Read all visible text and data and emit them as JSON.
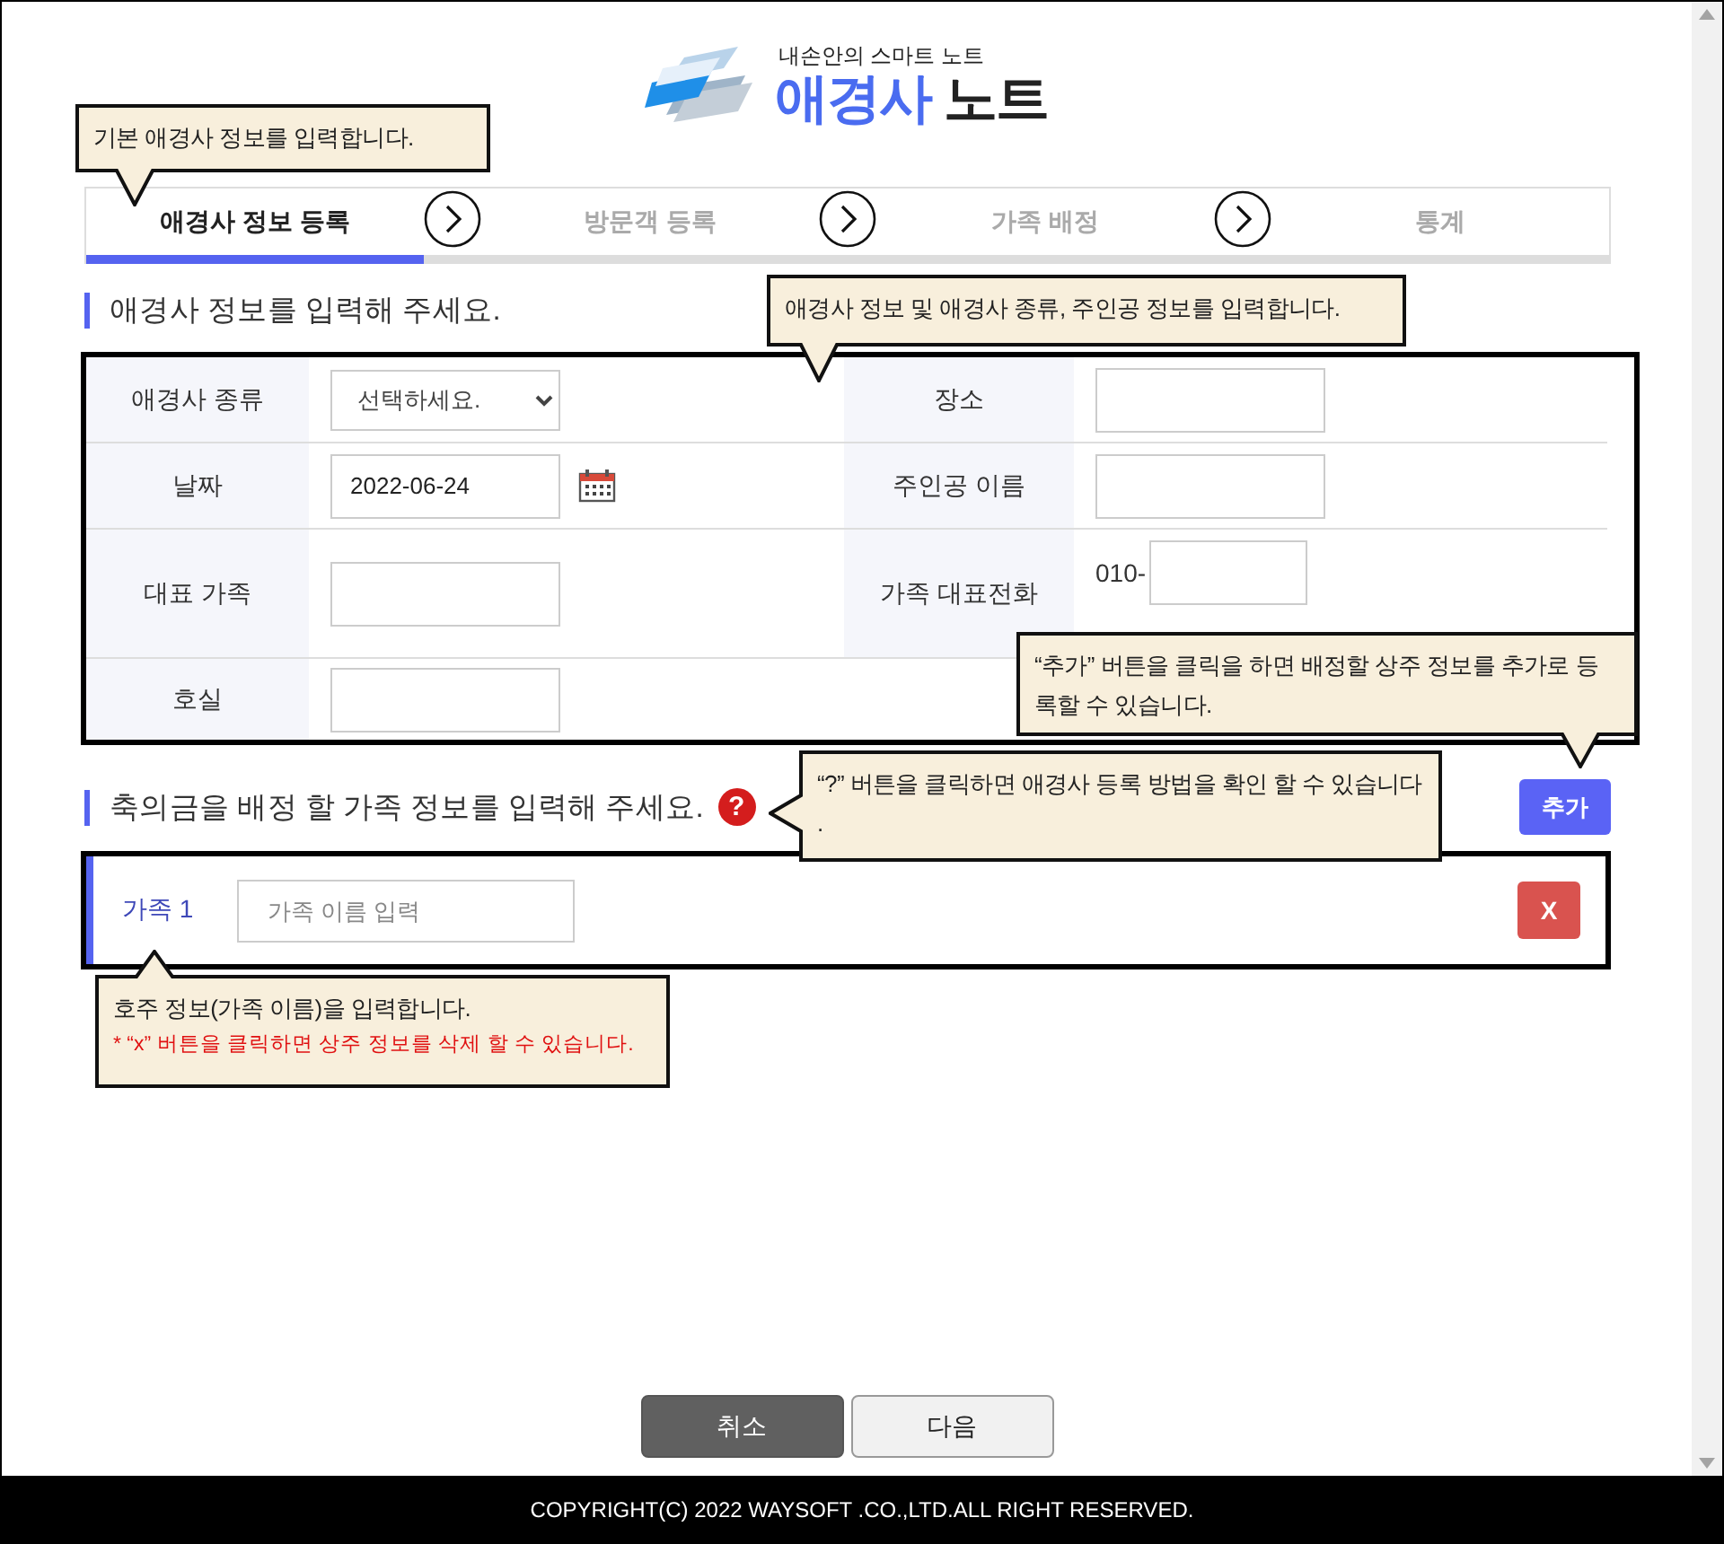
{
  "header": {
    "subtitle": "내손안의 스마트 노트",
    "title_accent": "애경사",
    "title_rest": "노트"
  },
  "steps": [
    {
      "label": "애경사 정보 등록",
      "selected": true
    },
    {
      "label": "방문객 등록",
      "selected": false
    },
    {
      "label": "가족 배정",
      "selected": false
    },
    {
      "label": "통계",
      "selected": false
    }
  ],
  "basic_info": {
    "heading": "애경사 정보를 입력해 주세요.",
    "rows": [
      [
        {
          "label": "애경사 종류",
          "kind": "select",
          "value": "선택하세요."
        },
        {
          "label": "장소",
          "kind": "text"
        }
      ],
      [
        {
          "label": "날짜",
          "kind": "date",
          "value": "2022-06-24"
        },
        {
          "label": "주인공 이름",
          "kind": "text"
        }
      ],
      [
        {
          "label": "대표 가족",
          "kind": "text"
        },
        {
          "label": "가족 대표전화",
          "kind": "phone",
          "prefix": "010-"
        }
      ],
      [
        {
          "label": "호실",
          "kind": "text"
        }
      ]
    ]
  },
  "family": {
    "heading": "축의금을 배정 할 가족 정보를 입력해 주세요.",
    "help": "?",
    "add_button": "추가",
    "rows": [
      {
        "label": "가족 1",
        "placeholder": "가족 이름 입력",
        "delete_button": "X"
      }
    ]
  },
  "actions": [
    {
      "label": "취소",
      "kind": "primary"
    },
    {
      "label": "다음",
      "kind": "secondary"
    }
  ],
  "tooltips": [
    {
      "text": "기본 애경사 정보를 입력합니다."
    },
    {
      "text": "애경사 정보 및 애경사 종류, 주인공 정보를 입력합니다."
    },
    {
      "text": "“추가” 버튼을 클릭을 하면 배정할 상주 정보를 추가로 등록할 수 있습니다."
    },
    {
      "text": "“?” 버튼을 클릭하면  애경사 등록 방법을 확인 할 수 있습니다 ."
    },
    {
      "text": "호주 정보(가족 이름)을 입력합니다.",
      "note": "* “x” 버튼을 클릭하면 상주 정보를 삭제 할 수 있습니다."
    }
  ],
  "footer": {
    "copyright": "COPYRIGHT(C) 2022 WAYSOFT .CO.,LTD.ALL RIGHT RESERVED."
  }
}
